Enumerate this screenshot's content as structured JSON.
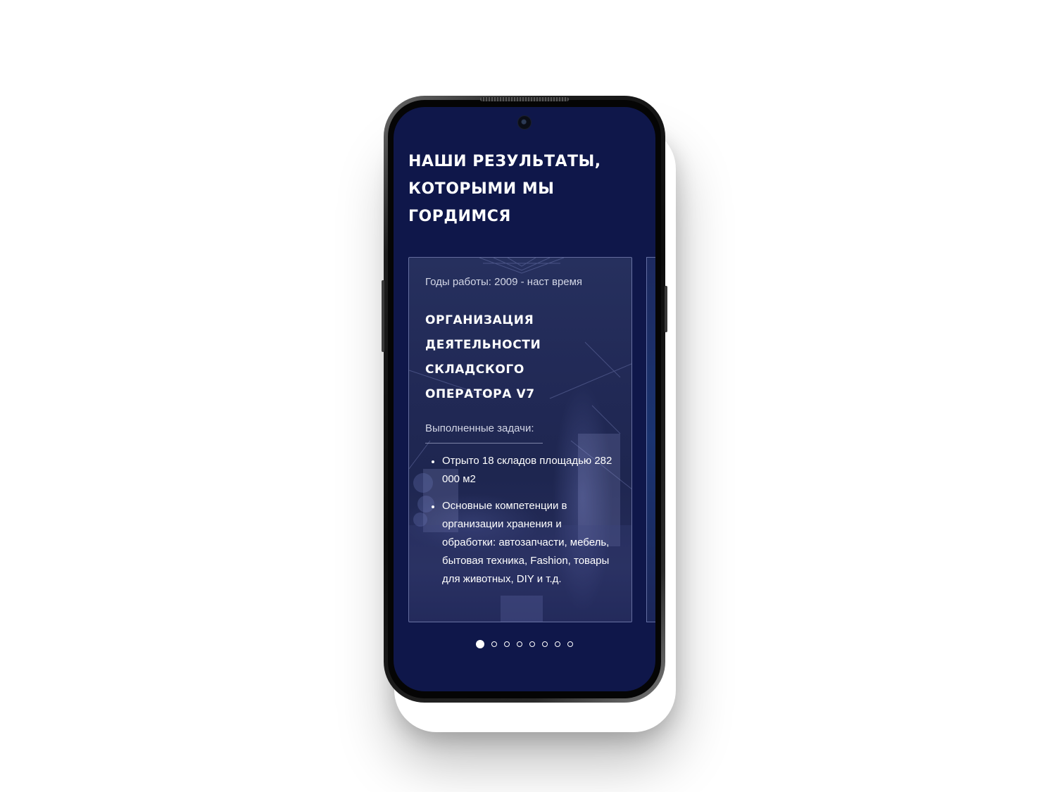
{
  "section": {
    "title": "НАШИ РЕЗУЛЬТАТЫ, КОТОРЫМИ МЫ ГОРДИМСЯ"
  },
  "carousel": {
    "active_index": 0,
    "total_slides": 8,
    "cards": [
      {
        "years": "Годы работы: 2009 - наст время",
        "title": "ОРГАНИЗАЦИЯ ДЕЯТЕЛЬНОСТИ СКЛАДСКОГО ОПЕРАТОРА V7",
        "tasks_label": "Выполненные задачи:",
        "tasks": [
          "Отрыто 18 складов площадью 282 000 м2",
          "Основные компетенции в организации хранения и обработки: автозапчасти, мебель, бытовая техника, Fashion, товары для животных, DIY и т.д."
        ]
      }
    ]
  },
  "colors": {
    "screen_background": "#0f174a",
    "text_primary": "#ffffff",
    "text_secondary": "#d3d6e6"
  }
}
